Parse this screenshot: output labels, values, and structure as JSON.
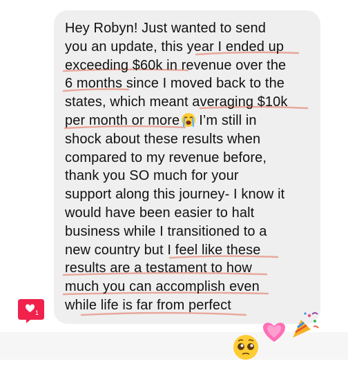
{
  "message": {
    "lines": [
      "Hey Robyn! Just wanted to send",
      "you an update, this year I ended up",
      "exceeding $60k in revenue over the",
      "6 months since I moved back to the",
      "states, which meant averaging $10k",
      "I’m still in",
      "shock about these results when",
      "compared to my revenue before,",
      "thank you SO much for your",
      "support along this journey- I know it",
      "would have been easier to halt",
      "business while I transitioned to a",
      "new country but I feel like these",
      "results are a testament to how",
      "much you can accomplish even",
      "while life is far from perfect"
    ],
    "line6_prefix": "per month or more",
    "inline_emoji": "loudly-crying-face"
  },
  "like_badge": {
    "count": "1",
    "icon": "heart-icon",
    "color": "#f0224c"
  },
  "reactions": [
    "pleading-face",
    "growing-heart",
    "party-popper"
  ],
  "colors": {
    "bubble": "#efefef",
    "text": "#111111",
    "underline": "#e8a79a",
    "background_strip": "#f6f6f7"
  }
}
